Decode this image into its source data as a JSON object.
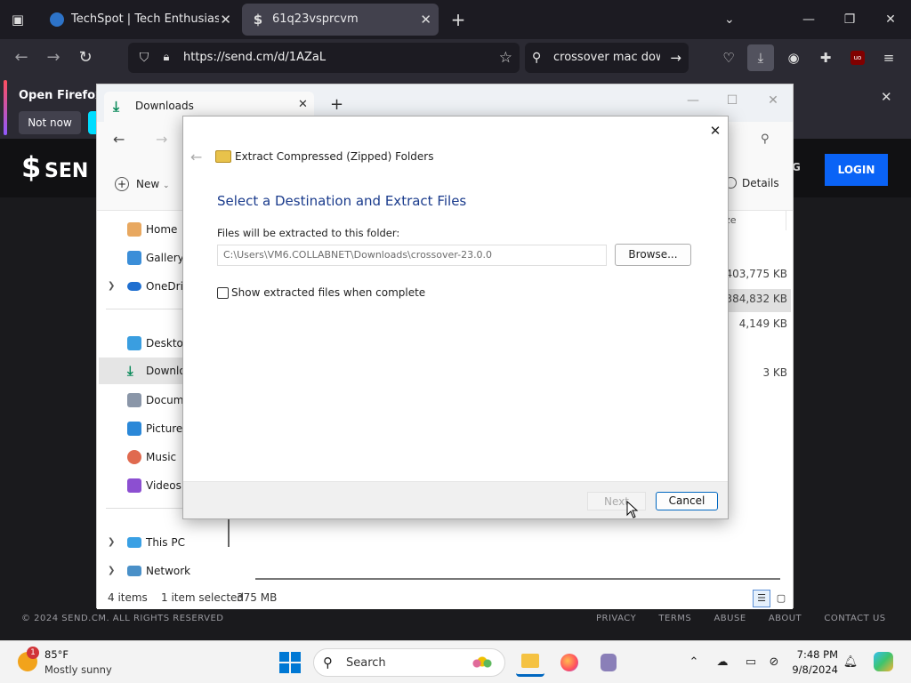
{
  "browser": {
    "tabs": [
      {
        "title": "TechSpot | Tech Enthusiasts, Po"
      },
      {
        "title": "61q23vsprcvm"
      }
    ],
    "url": "https://send.cm/d/1AZaL",
    "search_text": "crossover mac down"
  },
  "page": {
    "notification": {
      "text": "Open Firefox ev",
      "dismiss_label": "Not now"
    },
    "logo_text": "SEN",
    "nav_partial": "G",
    "login_label": "LOGIN",
    "footer": {
      "copyright": "© 2024 SEND.CM. ALL RIGHTS RESERVED",
      "links": [
        "PRIVACY",
        "TERMS",
        "ABUSE",
        "ABOUT",
        "CONTACT US"
      ]
    }
  },
  "explorer": {
    "tab_title": "Downloads",
    "new_label": "New",
    "details_label": "Details",
    "size_header": "ze",
    "sidebar": [
      {
        "label": "Home"
      },
      {
        "label": "Gallery"
      },
      {
        "label": "OneDriv"
      },
      {
        "label": "Desktop"
      },
      {
        "label": "Downlo"
      },
      {
        "label": "Docume"
      },
      {
        "label": "Pictures"
      },
      {
        "label": "Music"
      },
      {
        "label": "Videos"
      },
      {
        "label": "This PC"
      },
      {
        "label": "Network"
      }
    ],
    "sizes": [
      "403,775 KB",
      "384,832 KB",
      "4,149 KB",
      "3 KB"
    ],
    "status": {
      "items": "4 items",
      "selected": "1 item selected",
      "size": "375 MB"
    }
  },
  "wizard": {
    "title": "Extract Compressed (Zipped) Folders",
    "heading": "Select a Destination and Extract Files",
    "path_label": "Files will be extracted to this folder:",
    "path_value": "C:\\Users\\VM6.COLLABNET\\Downloads\\crossover-23.0.0",
    "browse_label": "Browse...",
    "checkbox_label": "Show extracted files when complete",
    "checkbox_checked": false,
    "next_label": "Next",
    "cancel_label": "Cancel"
  },
  "taskbar": {
    "weather": {
      "badge": "1",
      "temp": "85°F",
      "desc": "Mostly sunny"
    },
    "search_label": "Search",
    "time": "7:48 PM",
    "date": "9/8/2024"
  }
}
